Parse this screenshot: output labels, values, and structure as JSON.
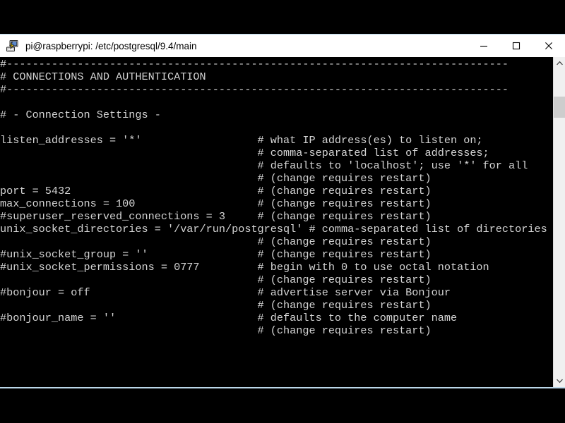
{
  "window": {
    "title": "pi@raspberrypi: /etc/postgresql/9.4/main",
    "icon": "putty-terminal-icon",
    "minimize_label": "—",
    "maximize_label": "□",
    "close_label": "✕",
    "titlebar_bg": "#ffffff",
    "border_color": "#bcd8ea"
  },
  "terminal": {
    "background": "#000000",
    "foreground": "#d4d4d4",
    "font_size_px": 15,
    "line_height_px": 18,
    "columns": 80,
    "content": "#------------------------------------------------------------------------------\n# CONNECTIONS AND AUTHENTICATION\n#------------------------------------------------------------------------------\n\n# - Connection Settings -\n\nlisten_addresses = '*'                  # what IP address(es) to listen on;\n                                        # comma-separated list of addresses;\n                                        # defaults to 'localhost'; use '*' for all\n                                        # (change requires restart)\nport = 5432                             # (change requires restart)\nmax_connections = 100                   # (change requires restart)\n#superuser_reserved_connections = 3     # (change requires restart)\nunix_socket_directories = '/var/run/postgresql' # comma-separated list of directories\n                                        # (change requires restart)\n#unix_socket_group = ''                 # (change requires restart)\n#unix_socket_permissions = 0777         # begin with 0 to use octal notation\n                                        # (change requires restart)\n#bonjour = off                          # advertise server via Bonjour\n                                        # (change requires restart)\n#bonjour_name = ''                      # defaults to the computer name\n                                        # (change requires restart)",
    "file_path": "/etc/postgresql/9.4/main",
    "user_host": "pi@raspberrypi"
  },
  "scrollbar": {
    "up_arrow": "∧",
    "down_arrow": "∨",
    "thumb_position": "near-top",
    "track_color": "#f0f0f0",
    "thumb_color": "#cdcdcd"
  }
}
